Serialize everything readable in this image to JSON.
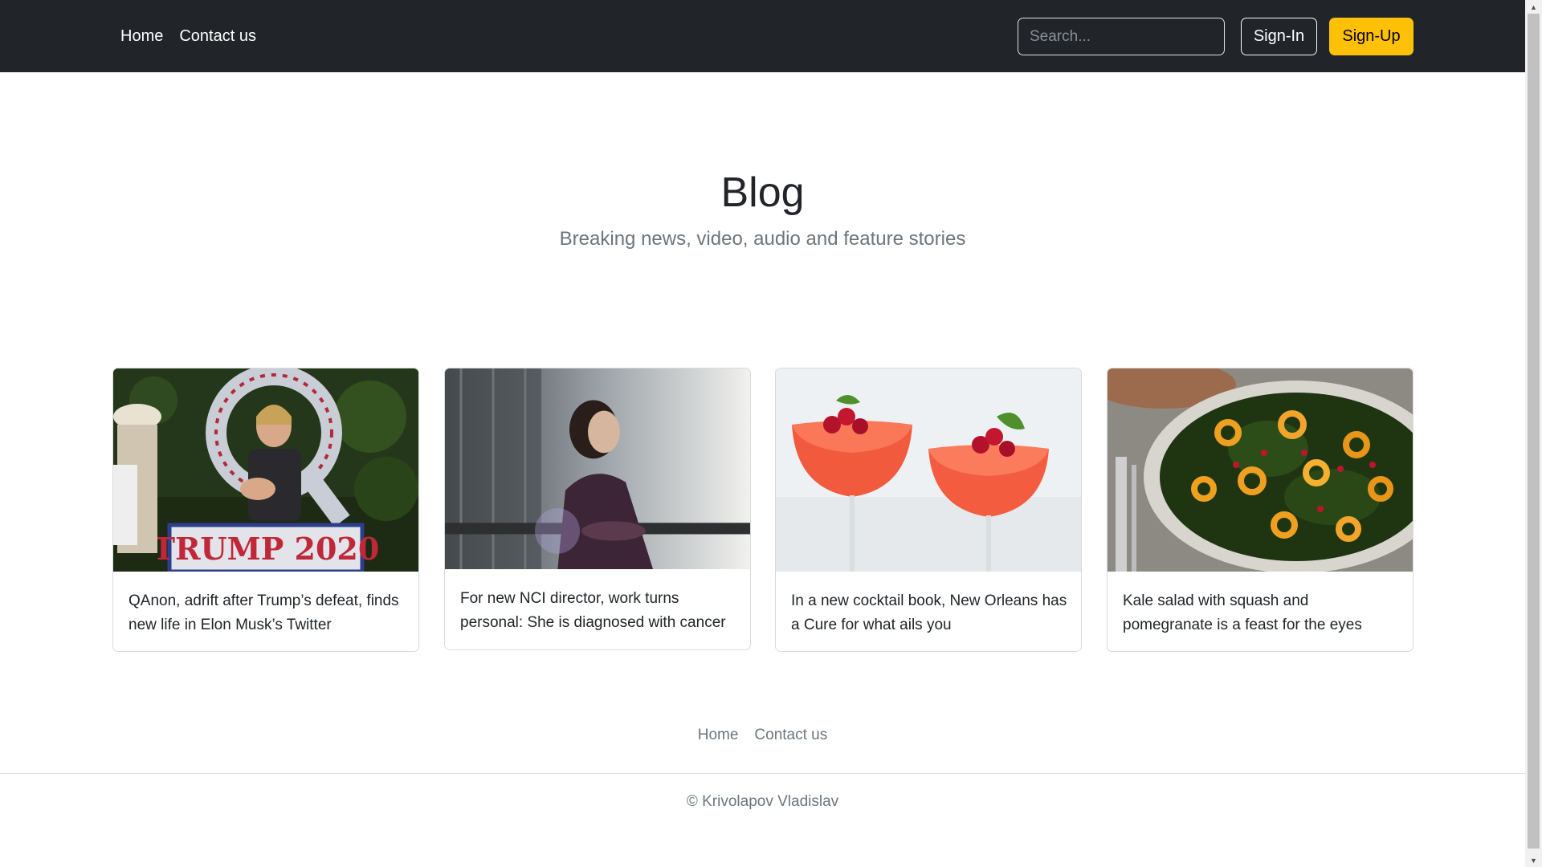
{
  "nav": {
    "links": [
      "Home",
      "Contact us"
    ],
    "search_placeholder": "Search...",
    "signin_label": "Sign-In",
    "signup_label": "Sign-Up"
  },
  "hero": {
    "title": "Blog",
    "subtitle": "Breaking news, video, audio and feature stories"
  },
  "cards": [
    {
      "text": "QAnon, adrift after Trump’s defeat, finds new life in Elon Musk’s Twitter",
      "image": "qanon-rally-photo"
    },
    {
      "text": "For new NCI director, work turns personal: She is diagnosed with cancer",
      "image": "woman-by-window-photo"
    },
    {
      "text": "In a new cocktail book, New Orleans has a Cure for what ails you",
      "image": "red-cocktails-photo"
    },
    {
      "text": "Kale salad with squash and pomegranate is a feast for the eyes",
      "image": "kale-salad-photo"
    }
  ],
  "footer": {
    "links": [
      "Home",
      "Contact us"
    ],
    "copyright": "© Krivolapov Vladislav"
  },
  "colors": {
    "navbar": "#212529",
    "accent": "#ffc107",
    "muted": "#6c757d"
  }
}
